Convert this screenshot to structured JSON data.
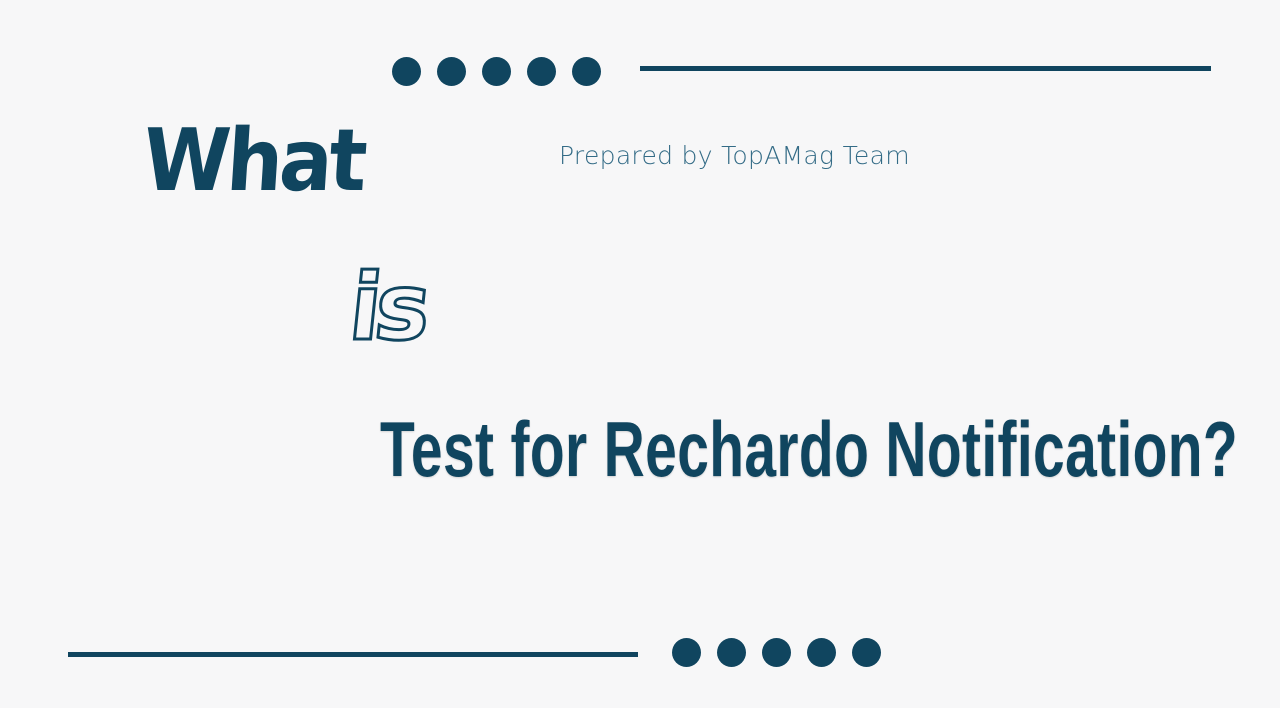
{
  "slide": {
    "title_word_1": "What",
    "title_word_2": "is",
    "headline": "Test for Rechardo Notification?",
    "byline": "Prepared by TopAMag Team"
  },
  "colors": {
    "primary": "#10455f",
    "byline": "#336b86",
    "background": "#f7f7f8"
  },
  "decorations": {
    "top_dots_count": 5,
    "bottom_dots_count": 5
  }
}
